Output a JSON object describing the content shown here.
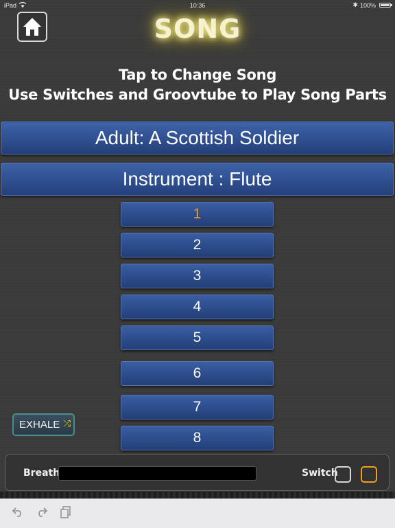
{
  "status": {
    "device": "iPad",
    "time": "10:36",
    "battery": "100%",
    "bluetooth_icon": "bluetooth-icon",
    "wifi_icon": "wifi-icon"
  },
  "header": {
    "home_icon": "home-icon",
    "title": "SONG"
  },
  "instructions": {
    "line1": "Tap to Change Song",
    "line2": "Use Switches and  Groovtube to Play Song Parts"
  },
  "song_button": {
    "label": "Adult: A Scottish Soldier"
  },
  "instrument_button": {
    "label": "Instrument : Flute"
  },
  "parts": [
    {
      "label": "1",
      "active": true
    },
    {
      "label": "2"
    },
    {
      "label": "3"
    },
    {
      "label": "4"
    },
    {
      "label": "5"
    },
    {
      "label": "6"
    },
    {
      "label": "7"
    },
    {
      "label": "8"
    }
  ],
  "exhale_button": {
    "label": "EXHALE",
    "icon": "shuffle-icon"
  },
  "bottom": {
    "breath_label": "Breath",
    "breath_level": 0,
    "switch_label": "Switch"
  },
  "colors": {
    "active_part": "#f29a2e",
    "switch1_border": "#d8d8d8",
    "switch2_border": "#f0a020",
    "button_blue": "#2f4f8f",
    "title_glow": "#fff7a0"
  },
  "toolbar": {
    "undo_icon": "undo-icon",
    "redo_icon": "redo-icon",
    "paste_icon": "paste-icon"
  }
}
